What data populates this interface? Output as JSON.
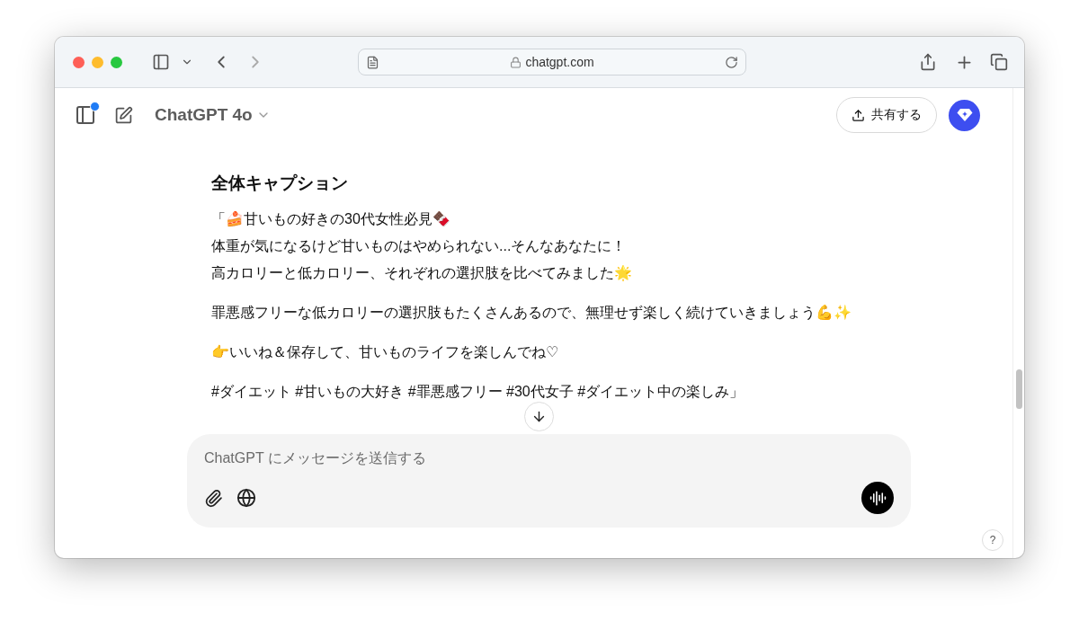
{
  "browser": {
    "address": "chatgpt.com"
  },
  "header": {
    "model": "ChatGPT 4o",
    "share": "共有する",
    "notification_dot": true
  },
  "message": {
    "heading": "全体キャプション",
    "paragraphs": [
      [
        "「🍰甘いもの好きの30代女性必見🍫",
        "体重が気になるけど甘いものはやめられない...そんなあなたに！",
        "高カロリーと低カロリー、それぞれの選択肢を比べてみました🌟"
      ],
      [
        "罪悪感フリーな低カロリーの選択肢もたくさんあるので、無理せず楽しく続けていきましょう💪✨"
      ],
      [
        "👉いいね＆保存して、甘いものライフを楽しんでね♡"
      ],
      [
        "#ダイエット #甘いもの大好き #罪悪感フリー #30代女子 #ダイエット中の楽しみ」"
      ]
    ]
  },
  "composer": {
    "placeholder": "ChatGPT にメッセージを送信する"
  },
  "help": "?"
}
